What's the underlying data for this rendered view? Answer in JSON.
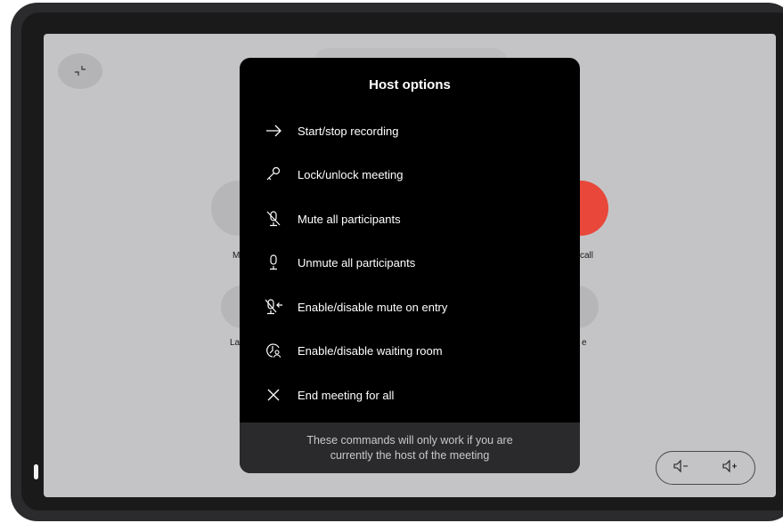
{
  "modal": {
    "title": "Host options",
    "options": [
      {
        "label": "Start/stop recording",
        "icon": "arrow-right-icon"
      },
      {
        "label": "Lock/unlock meeting",
        "icon": "key-icon"
      },
      {
        "label": "Mute all participants",
        "icon": "microphone-muted-icon"
      },
      {
        "label": "Unmute all participants",
        "icon": "microphone-icon"
      },
      {
        "label": "Enable/disable mute on entry",
        "icon": "microphone-entry-icon"
      },
      {
        "label": "Enable/disable waiting room",
        "icon": "waiting-room-icon"
      },
      {
        "label": "End meeting for all",
        "icon": "close-icon"
      }
    ],
    "footer_line1": "These commands will only work if you are",
    "footer_line2": "currently the host of the meeting"
  },
  "background": {
    "label_left_top": "M",
    "label_right_top": "call",
    "label_left_bottom": "La",
    "label_right_bottom": "e"
  },
  "colors": {
    "end_call": "#e8473a",
    "modal_bg": "#000000",
    "screen_bg": "#c4c4c6"
  },
  "volume": {
    "down_icon": "volume-down-icon",
    "up_icon": "volume-up-icon"
  }
}
